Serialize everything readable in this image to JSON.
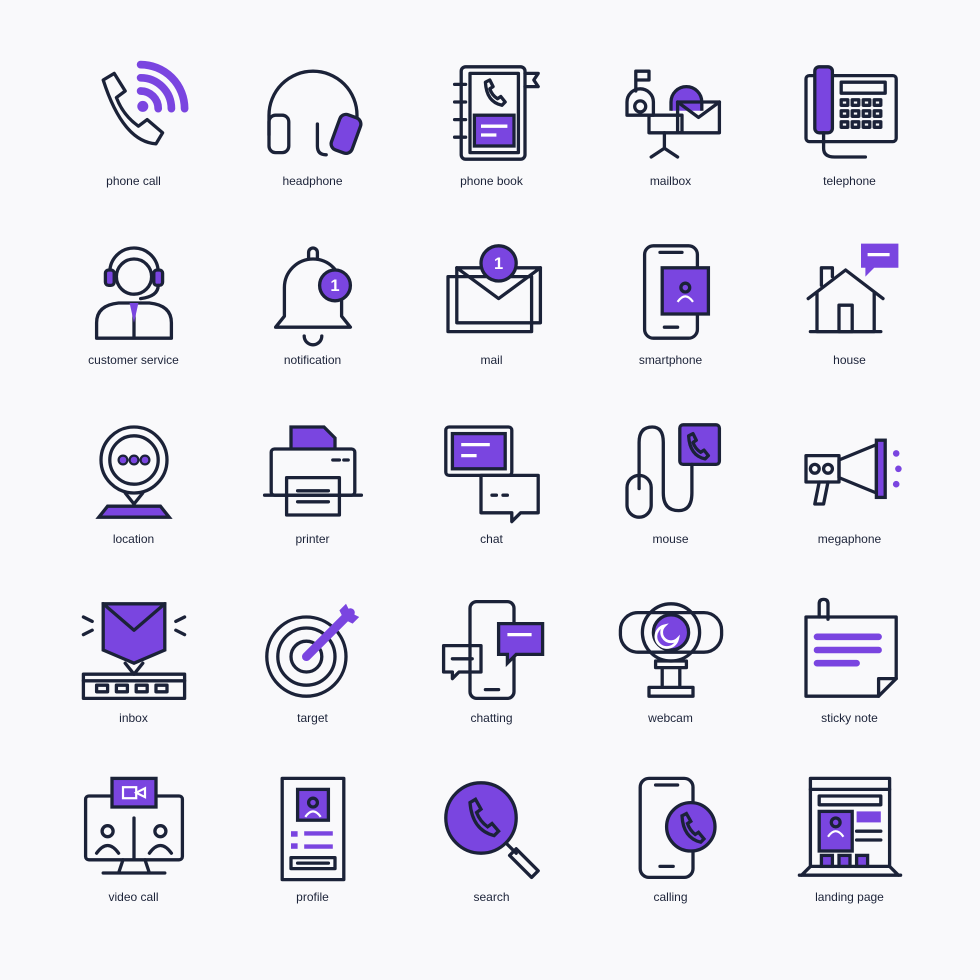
{
  "colors": {
    "outline": "#1b2238",
    "accent": "#7a45e0",
    "background": "#f9f9fb"
  },
  "icons": [
    {
      "id": "phone-call",
      "label": "phone call"
    },
    {
      "id": "headphone",
      "label": "headphone"
    },
    {
      "id": "phone-book",
      "label": "phone book"
    },
    {
      "id": "mailbox",
      "label": "mailbox"
    },
    {
      "id": "telephone",
      "label": "telephone"
    },
    {
      "id": "customer-service",
      "label": "customer service"
    },
    {
      "id": "notification",
      "label": "notification",
      "badge": "1"
    },
    {
      "id": "mail",
      "label": "mail",
      "badge": "1"
    },
    {
      "id": "smartphone",
      "label": "smartphone"
    },
    {
      "id": "house",
      "label": "house"
    },
    {
      "id": "location",
      "label": "location"
    },
    {
      "id": "printer",
      "label": "printer"
    },
    {
      "id": "chat",
      "label": "chat"
    },
    {
      "id": "mouse",
      "label": "mouse"
    },
    {
      "id": "megaphone",
      "label": "megaphone"
    },
    {
      "id": "inbox",
      "label": "inbox"
    },
    {
      "id": "target",
      "label": "target"
    },
    {
      "id": "chatting",
      "label": "chatting"
    },
    {
      "id": "webcam",
      "label": "webcam"
    },
    {
      "id": "sticky-note",
      "label": "sticky note"
    },
    {
      "id": "video-call",
      "label": "video call"
    },
    {
      "id": "profile",
      "label": "profile"
    },
    {
      "id": "search",
      "label": "search"
    },
    {
      "id": "calling",
      "label": "calling"
    },
    {
      "id": "landing-page",
      "label": "landing page"
    }
  ]
}
